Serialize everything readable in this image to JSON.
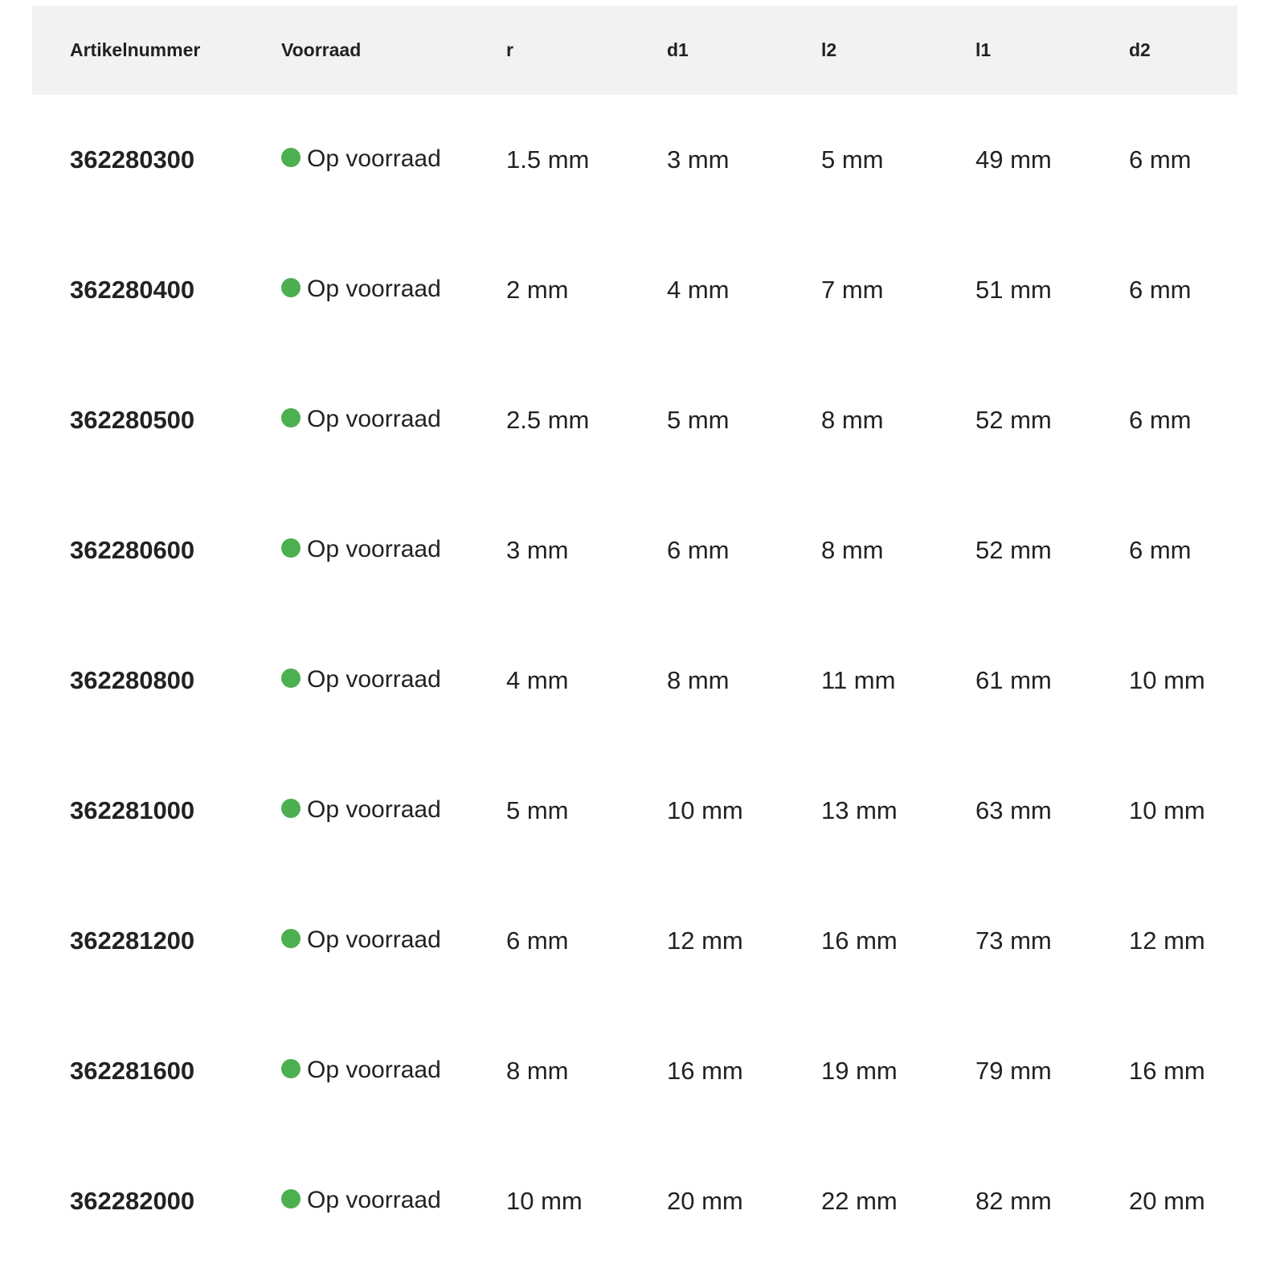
{
  "colors": {
    "header_bg": "#f2f2f2",
    "stock_ok": "#4caf50",
    "text": "#222222"
  },
  "table": {
    "headers": [
      "Artikelnummer",
      "Voorraad",
      "r",
      "d1",
      "l2",
      "l1",
      "d2"
    ],
    "rows": [
      {
        "article": "362280300",
        "stock": "Op voorraad",
        "r": "1.5 mm",
        "d1": "3 mm",
        "l2": "5 mm",
        "l1": "49 mm",
        "d2": "6 mm"
      },
      {
        "article": "362280400",
        "stock": "Op voorraad",
        "r": "2 mm",
        "d1": "4 mm",
        "l2": "7 mm",
        "l1": "51 mm",
        "d2": "6 mm"
      },
      {
        "article": "362280500",
        "stock": "Op voorraad",
        "r": "2.5 mm",
        "d1": "5 mm",
        "l2": "8 mm",
        "l1": "52 mm",
        "d2": "6 mm"
      },
      {
        "article": "362280600",
        "stock": "Op voorraad",
        "r": "3 mm",
        "d1": "6 mm",
        "l2": "8 mm",
        "l1": "52 mm",
        "d2": "6 mm"
      },
      {
        "article": "362280800",
        "stock": "Op voorraad",
        "r": "4 mm",
        "d1": "8 mm",
        "l2": "11 mm",
        "l1": "61 mm",
        "d2": "10 mm"
      },
      {
        "article": "362281000",
        "stock": "Op voorraad",
        "r": "5 mm",
        "d1": "10 mm",
        "l2": "13 mm",
        "l1": "63 mm",
        "d2": "10 mm"
      },
      {
        "article": "362281200",
        "stock": "Op voorraad",
        "r": "6 mm",
        "d1": "12 mm",
        "l2": "16 mm",
        "l1": "73 mm",
        "d2": "12 mm"
      },
      {
        "article": "362281600",
        "stock": "Op voorraad",
        "r": "8 mm",
        "d1": "16 mm",
        "l2": "19 mm",
        "l1": "79 mm",
        "d2": "16 mm"
      },
      {
        "article": "362282000",
        "stock": "Op voorraad",
        "r": "10 mm",
        "d1": "20 mm",
        "l2": "22 mm",
        "l1": "82 mm",
        "d2": "20 mm"
      }
    ]
  }
}
